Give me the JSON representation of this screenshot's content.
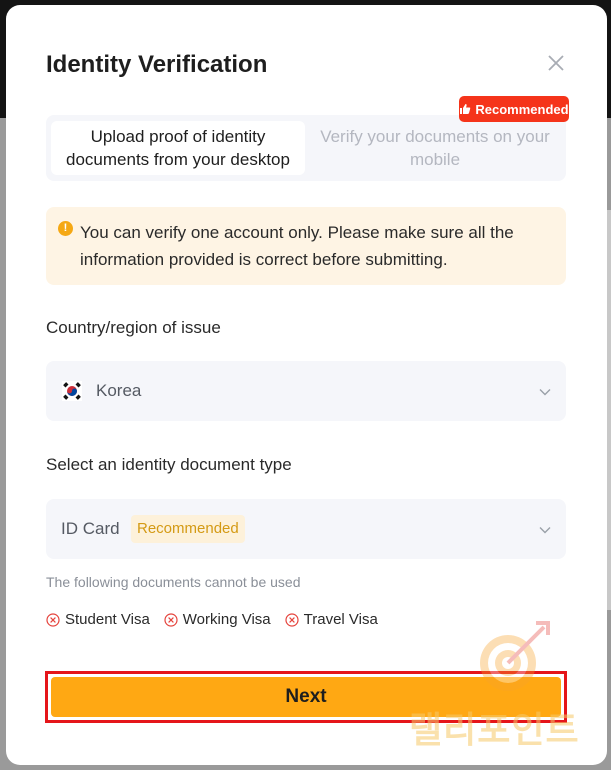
{
  "modal": {
    "title": "Identity Verification",
    "close_icon": "close-icon"
  },
  "tabs": {
    "upload_label": "Upload proof of identity documents from your desktop",
    "mobile_label": "Verify your documents on your mobile",
    "recommended_tag": "Recommended",
    "recommended_icon": "thumbs-up-icon"
  },
  "notice": {
    "icon": "warning-icon",
    "text": "You can verify one account only. Please make sure all the information provided is correct before submitting."
  },
  "country": {
    "label": "Country/region of issue",
    "value": "Korea",
    "flag_icon": "korea-flag-icon"
  },
  "document": {
    "label": "Select an identity document type",
    "value": "ID Card",
    "badge": "Recommended"
  },
  "exclusions": {
    "hint": "The following documents cannot be used",
    "items": [
      "Student Visa",
      "Working Visa",
      "Travel Visa"
    ]
  },
  "actions": {
    "next_label": "Next"
  },
  "watermark": {
    "text": "랠리포인트"
  },
  "colors": {
    "accent": "#ffa813",
    "highlight": "#e5151a",
    "recommended_red": "#f5341a",
    "notice_bg": "#fef4e4"
  }
}
